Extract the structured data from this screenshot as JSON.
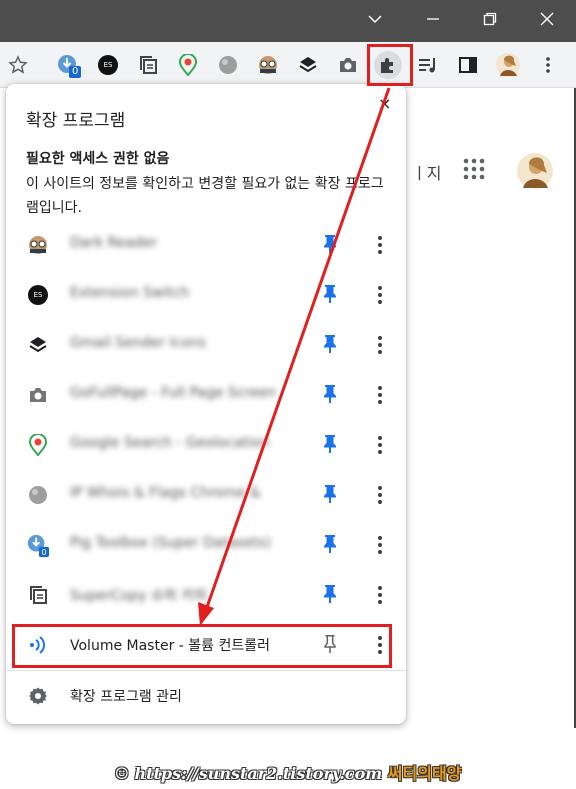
{
  "popup": {
    "title": "확장 프로그램",
    "close_glyph": "×",
    "section_title": "필요한 액세스 권한 없음",
    "section_description": "이 사이트의 정보를 확인하고 변경할 필요가 없는 확장 프로그램입니다.",
    "extensions": [
      {
        "name": "Dark Reader",
        "icon": "dark-reader-icon",
        "pinned": true,
        "blurred": true
      },
      {
        "name": "Extension Switch",
        "icon": "es-icon",
        "pinned": true,
        "blurred": true
      },
      {
        "name": "Gmail Sender Icons",
        "icon": "layers-icon",
        "pinned": true,
        "blurred": true
      },
      {
        "name": "GoFullPage - Full Page Screen",
        "icon": "camera-icon",
        "pinned": true,
        "blurred": true
      },
      {
        "name": "Google Search - Geolocation",
        "icon": "location-pin-icon",
        "pinned": true,
        "blurred": true
      },
      {
        "name": "IP Whois & Flags Chrome &",
        "icon": "globe-icon",
        "pinned": true,
        "blurred": true
      },
      {
        "name": "Pig Toolbox (Super Datasets)",
        "icon": "download-badge-icon",
        "pinned": true,
        "blurred": true
      },
      {
        "name": "SuperCopy 슈퍼 카피",
        "icon": "copy-icon",
        "pinned": true,
        "blurred": true
      },
      {
        "name": "Volume Master - 볼륨 컨트롤러",
        "icon": "volume-icon",
        "pinned": false,
        "blurred": false
      }
    ],
    "manage_label": "확장 프로그램 관리"
  },
  "toolbar": {
    "badge_count": "0",
    "es_label": "ES"
  },
  "background": {
    "partial_text": "ㅣ지"
  },
  "watermark": {
    "url": "https://sunstar2.tistory.com",
    "name": "써티의태양"
  },
  "colors": {
    "pin_blue": "#1a73e8",
    "highlight_red": "#e02020",
    "titlebar": "#4d4d4d"
  }
}
